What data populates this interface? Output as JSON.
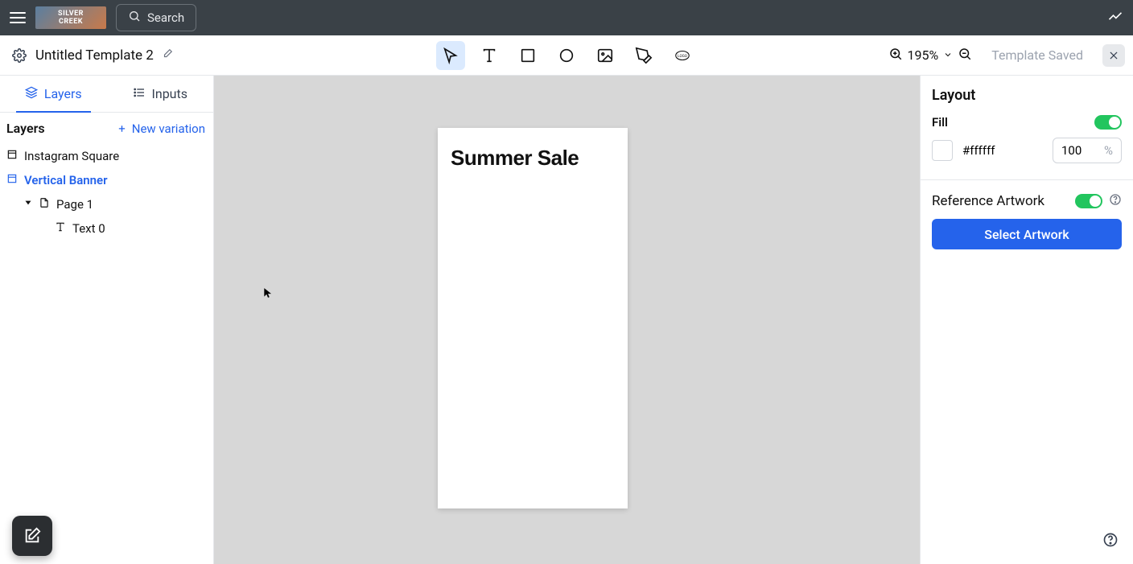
{
  "topbar": {
    "search_label": "Search",
    "brand_name": "SILVER CREEK"
  },
  "titlebar": {
    "template_name": "Untitled Template 2",
    "zoom_value": "195%",
    "save_status": "Template Saved"
  },
  "panel_tabs": {
    "layers": "Layers",
    "inputs": "Inputs"
  },
  "layers_panel": {
    "heading": "Layers",
    "new_variation": "New variation",
    "items": {
      "instagram_square": "Instagram Square",
      "vertical_banner": "Vertical Banner",
      "page1": "Page 1",
      "text0": "Text 0"
    }
  },
  "canvas": {
    "text0_content": "Summer Sale"
  },
  "right": {
    "section": "Layout",
    "fill_label": "Fill",
    "fill_hex": "#ffffff",
    "fill_opacity": "100",
    "percent_symbol": "%",
    "reference_label": "Reference Artwork",
    "select_artwork": "Select Artwork"
  }
}
